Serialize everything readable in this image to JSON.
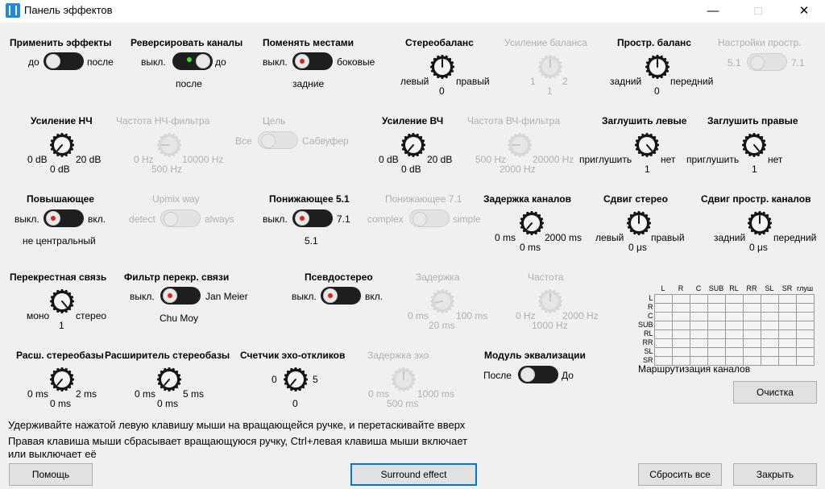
{
  "window": {
    "title": "Панель эффектов"
  },
  "controls": {
    "apply": {
      "title": "Применить эффекты",
      "left": "до",
      "right": "после"
    },
    "reverse": {
      "title": "Реверсировать каналы",
      "left": "выкл.",
      "right": "до",
      "bottom": "после"
    },
    "swap": {
      "title": "Поменять местами",
      "left": "выкл.",
      "right": "боковые",
      "bottom": "задние"
    },
    "stereobal": {
      "title": "Стереобаланс",
      "left": "левый",
      "right": "правый",
      "value": "0"
    },
    "balgain": {
      "title": "Усиление баланса",
      "left": "1",
      "right": "2",
      "value": "1"
    },
    "spatbal": {
      "title": "Простр. баланс",
      "left": "задний",
      "right": "передний",
      "value": "0"
    },
    "spatset": {
      "title": "Настройки простр.",
      "left": "5.1",
      "right": "7.1"
    },
    "bassgain": {
      "title": "Усиление НЧ",
      "left": "0 dB",
      "right": "20 dB",
      "value": "0 dB"
    },
    "lpfreq": {
      "title": "Частота НЧ-фильтра",
      "left": "0 Hz",
      "right": "10000 Hz",
      "value": "500 Hz"
    },
    "target": {
      "title": "Цель",
      "left": "Все",
      "right": "Сабвуфер"
    },
    "treblegain": {
      "title": "Усиление ВЧ",
      "left": "0 dB",
      "right": "20 dB",
      "value": "0 dB"
    },
    "hpfreq": {
      "title": "Частота ВЧ-фильтра",
      "left": "500 Hz",
      "right": "20000 Hz",
      "value": "2000 Hz"
    },
    "muteleft": {
      "title": "Заглушить левые",
      "left": "приглушить",
      "right": "нет",
      "value": "1"
    },
    "muteright": {
      "title": "Заглушить правые",
      "left": "приглушить",
      "right": "нет",
      "value": "1"
    },
    "upmix": {
      "title": "Повышающее",
      "left": "выкл.",
      "right": "вкл.",
      "bottom": "не центральный"
    },
    "upmixway": {
      "title": "Upmix way",
      "left": "detect",
      "right": "always"
    },
    "down51": {
      "title": "Понижающее 5.1",
      "left": "выкл.",
      "right": "7.1",
      "bottom": "5.1"
    },
    "down71": {
      "title": "Понижающее 7.1",
      "left": "complex",
      "right": "simple"
    },
    "chdelay": {
      "title": "Задержка каналов",
      "left": "0 ms",
      "right": "2000 ms",
      "value": "0 ms"
    },
    "stereoshift": {
      "title": "Сдвиг стерео",
      "left": "левый",
      "right": "правый",
      "value": "0 μs"
    },
    "spatshift": {
      "title": "Сдвиг простр. каналов",
      "left": "задний",
      "right": "передний",
      "value": "0 μs"
    },
    "crossfeed": {
      "title": "Перекрестная связь",
      "left": "моно",
      "right": "стерео",
      "value": "1"
    },
    "cfilter": {
      "title": "Фильтр перекр. связи",
      "left": "выкл.",
      "right": "Jan Meier",
      "bottom": "Chu Moy"
    },
    "pseudo": {
      "title": "Псевдостерео",
      "left": "выкл.",
      "right": "вкл."
    },
    "pdelay": {
      "title": "Задержка",
      "left": "0 ms",
      "right": "100 ms",
      "value": "20 ms"
    },
    "pfreq": {
      "title": "Частота",
      "left": "0 Hz",
      "right": "2000 Hz",
      "value": "1000 Hz"
    },
    "widen1": {
      "title": "Расш. стереобазы",
      "left": "0 ms",
      "right": "2 ms",
      "value": "0 ms"
    },
    "widen2": {
      "title": "Расширитель стереобазы",
      "left": "0 ms",
      "right": "5 ms",
      "value": "0 ms"
    },
    "echocount": {
      "title": "Счетчик эхо-откликов",
      "left": "0",
      "right": "5",
      "value": "0"
    },
    "echodelay": {
      "title": "Задержка эхо",
      "left": "0 ms",
      "right": "1000 ms",
      "value": "500 ms"
    },
    "eqmodule": {
      "title": "Модуль эквализации",
      "left": "После",
      "right": "До"
    }
  },
  "routing": {
    "title": "Маршрутизация каналов",
    "columns": [
      "L",
      "R",
      "C",
      "SUB",
      "RL",
      "RR",
      "SL",
      "SR",
      "глуш"
    ],
    "rows": [
      "L",
      "R",
      "C",
      "SUB",
      "RL",
      "RR",
      "SL",
      "SR"
    ],
    "clear_label": "Очистка"
  },
  "help": {
    "line1": "Удерживайте нажатой левую клавишу мыши на вращающейся ручке, и перетаскивайте вверх",
    "line2": "Правая клавиша мыши сбрасывает вращающуюся ручку, Ctrl+левая клавиша мыши включает",
    "line3": "или выключает её"
  },
  "buttons": {
    "help": "Помощь",
    "surround": "Surround effect",
    "reset": "Сбросить все",
    "close": "Закрыть"
  },
  "colors": {
    "led_green": "#3adf3a",
    "led_red": "#e02020",
    "focus": "#0078d7"
  }
}
